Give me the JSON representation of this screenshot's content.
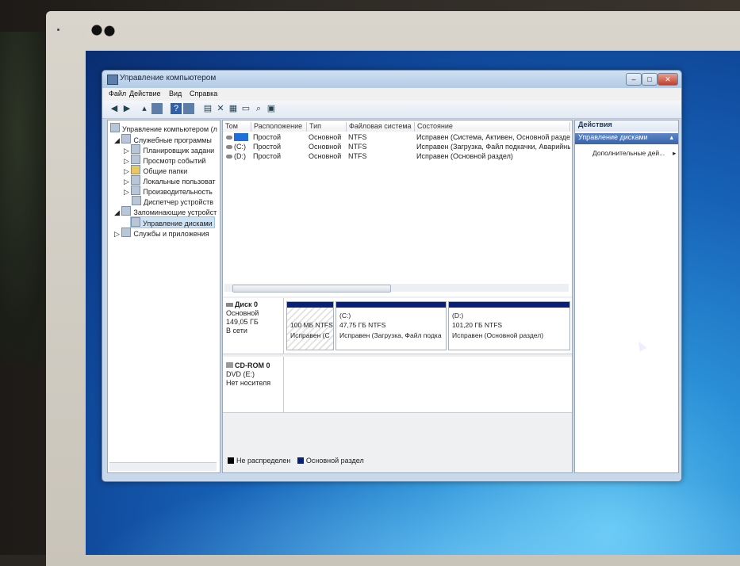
{
  "window": {
    "title": "Управление компьютером",
    "controls": {
      "minimize": "–",
      "maximize": "□",
      "close": "✕"
    }
  },
  "menu": [
    "Файл",
    "Действие",
    "Вид",
    "Справка"
  ],
  "toolbar_icons": [
    "back-arrow-icon",
    "forward-arrow-icon",
    "up-folder-icon",
    "show-tree-icon",
    "help-icon",
    "properties-icon",
    "export-icon",
    "delete-icon",
    "connect-icon",
    "open-icon",
    "search-icon",
    "settings-icon"
  ],
  "tree": {
    "root": "Управление компьютером (л",
    "items": [
      {
        "label": "Служебные программы",
        "level": 1
      },
      {
        "label": "Планировщик задани",
        "level": 2
      },
      {
        "label": "Просмотр событий",
        "level": 2
      },
      {
        "label": "Общие папки",
        "level": 2
      },
      {
        "label": "Локальные пользоват",
        "level": 2
      },
      {
        "label": "Производительность",
        "level": 2
      },
      {
        "label": "Диспетчер устройств",
        "level": 2
      },
      {
        "label": "Запоминающие устройст",
        "level": 1
      },
      {
        "label": "Управление дисками",
        "level": 2
      },
      {
        "label": "Службы и приложения",
        "level": 1
      }
    ]
  },
  "volumes": {
    "columns": [
      "Том",
      "Расположение",
      "Тип",
      "Файловая система",
      "Состояние"
    ],
    "rows": [
      {
        "name": "",
        "layout": "Простой",
        "type": "Основной",
        "fs": "NTFS",
        "status": "Исправен (Система, Активен, Основной раздел)"
      },
      {
        "name": "(C:)",
        "layout": "Простой",
        "type": "Основной",
        "fs": "NTFS",
        "status": "Исправен (Загрузка, Файл подкачки, Аварийны"
      },
      {
        "name": "(D:)",
        "layout": "Простой",
        "type": "Основной",
        "fs": "NTFS",
        "status": "Исправен (Основной раздел)"
      }
    ]
  },
  "disks": [
    {
      "title": "Диск 0",
      "kind": "Основной",
      "size": "149,05 ГБ",
      "state": "В сети",
      "partitions": [
        {
          "name": "",
          "size": "100 МБ NTFS",
          "status": "Исправен (С"
        },
        {
          "name": "(C:)",
          "size": "47,75 ГБ NTFS",
          "status": "Исправен (Загрузка, Файл подка"
        },
        {
          "name": "(D:)",
          "size": "101,20 ГБ NTFS",
          "status": "Исправен (Основной раздел)"
        }
      ]
    },
    {
      "title": "CD-ROM 0",
      "kind": "DVD (E:)",
      "size": "",
      "state": "Нет носителя"
    }
  ],
  "legend": {
    "unallocated": "Не распределен",
    "primary": "Основной раздел",
    "colors": {
      "unallocated": "#000000",
      "primary": "#0a1f78"
    }
  },
  "actions": {
    "header": "Действия",
    "section": "Управление дисками",
    "more": "Дополнительные дей..."
  }
}
